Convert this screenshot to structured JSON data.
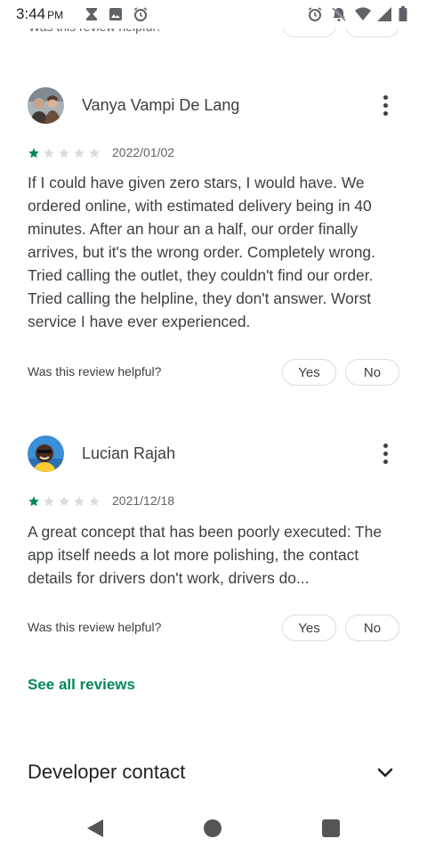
{
  "status_bar": {
    "time": "3:44",
    "ampm": "PM",
    "left_icons": [
      "hourglass-icon",
      "image-icon",
      "alarm-icon"
    ],
    "right_icons": [
      "alarm-icon",
      "notifications-off-icon",
      "wifi-icon",
      "signal-icon",
      "battery-icon"
    ]
  },
  "prev_review": {
    "helpful_label": "Was this review helpful?"
  },
  "reviews": [
    {
      "name": "Vanya Vampi De Lang",
      "rating": 1,
      "max_rating": 5,
      "date": "2022/01/02",
      "text": "If I could have given zero stars, I would have. We ordered online, with estimated delivery being in 40 minutes. After an hour an a half, our order finally arrives, but it's the wrong order. Completely wrong. Tried calling the outlet, they couldn't find our order. Tried calling the helpline, they don't answer. Worst service I have ever experienced.",
      "helpful_label": "Was this review helpful?",
      "yes_label": "Yes",
      "no_label": "No"
    },
    {
      "name": "Lucian Rajah",
      "rating": 1,
      "max_rating": 5,
      "date": "2021/12/18",
      "text": "A great concept that has been poorly executed: The app itself needs a lot more polishing, the contact details for drivers don't work, drivers do...",
      "helpful_label": "Was this review helpful?",
      "yes_label": "Yes",
      "no_label": "No"
    }
  ],
  "see_all_label": "See all reviews",
  "developer_contact_label": "Developer contact",
  "colors": {
    "accent": "#01875f",
    "star_filled": "#01875f",
    "star_empty": "#dadce0",
    "text_primary": "#202124",
    "text_secondary": "#5f6368"
  },
  "nav": {
    "icons": [
      "back-icon",
      "home-icon",
      "recents-icon"
    ]
  }
}
